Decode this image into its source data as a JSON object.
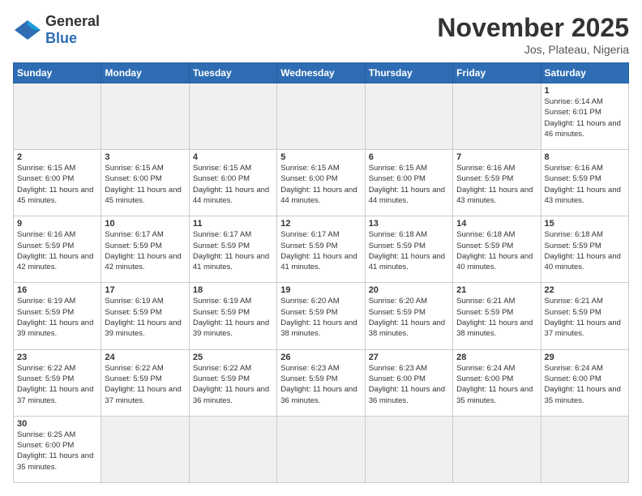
{
  "header": {
    "logo_general": "General",
    "logo_blue": "Blue",
    "month_title": "November 2025",
    "location": "Jos, Plateau, Nigeria"
  },
  "days_of_week": [
    "Sunday",
    "Monday",
    "Tuesday",
    "Wednesday",
    "Thursday",
    "Friday",
    "Saturday"
  ],
  "weeks": [
    [
      {
        "day": "",
        "info": ""
      },
      {
        "day": "",
        "info": ""
      },
      {
        "day": "",
        "info": ""
      },
      {
        "day": "",
        "info": ""
      },
      {
        "day": "",
        "info": ""
      },
      {
        "day": "",
        "info": ""
      },
      {
        "day": "1",
        "info": "Sunrise: 6:14 AM\nSunset: 6:01 PM\nDaylight: 11 hours and 46 minutes."
      }
    ],
    [
      {
        "day": "2",
        "info": "Sunrise: 6:15 AM\nSunset: 6:00 PM\nDaylight: 11 hours and 45 minutes."
      },
      {
        "day": "3",
        "info": "Sunrise: 6:15 AM\nSunset: 6:00 PM\nDaylight: 11 hours and 45 minutes."
      },
      {
        "day": "4",
        "info": "Sunrise: 6:15 AM\nSunset: 6:00 PM\nDaylight: 11 hours and 44 minutes."
      },
      {
        "day": "5",
        "info": "Sunrise: 6:15 AM\nSunset: 6:00 PM\nDaylight: 11 hours and 44 minutes."
      },
      {
        "day": "6",
        "info": "Sunrise: 6:15 AM\nSunset: 6:00 PM\nDaylight: 11 hours and 44 minutes."
      },
      {
        "day": "7",
        "info": "Sunrise: 6:16 AM\nSunset: 5:59 PM\nDaylight: 11 hours and 43 minutes."
      },
      {
        "day": "8",
        "info": "Sunrise: 6:16 AM\nSunset: 5:59 PM\nDaylight: 11 hours and 43 minutes."
      }
    ],
    [
      {
        "day": "9",
        "info": "Sunrise: 6:16 AM\nSunset: 5:59 PM\nDaylight: 11 hours and 42 minutes."
      },
      {
        "day": "10",
        "info": "Sunrise: 6:17 AM\nSunset: 5:59 PM\nDaylight: 11 hours and 42 minutes."
      },
      {
        "day": "11",
        "info": "Sunrise: 6:17 AM\nSunset: 5:59 PM\nDaylight: 11 hours and 41 minutes."
      },
      {
        "day": "12",
        "info": "Sunrise: 6:17 AM\nSunset: 5:59 PM\nDaylight: 11 hours and 41 minutes."
      },
      {
        "day": "13",
        "info": "Sunrise: 6:18 AM\nSunset: 5:59 PM\nDaylight: 11 hours and 41 minutes."
      },
      {
        "day": "14",
        "info": "Sunrise: 6:18 AM\nSunset: 5:59 PM\nDaylight: 11 hours and 40 minutes."
      },
      {
        "day": "15",
        "info": "Sunrise: 6:18 AM\nSunset: 5:59 PM\nDaylight: 11 hours and 40 minutes."
      }
    ],
    [
      {
        "day": "16",
        "info": "Sunrise: 6:19 AM\nSunset: 5:59 PM\nDaylight: 11 hours and 39 minutes."
      },
      {
        "day": "17",
        "info": "Sunrise: 6:19 AM\nSunset: 5:59 PM\nDaylight: 11 hours and 39 minutes."
      },
      {
        "day": "18",
        "info": "Sunrise: 6:19 AM\nSunset: 5:59 PM\nDaylight: 11 hours and 39 minutes."
      },
      {
        "day": "19",
        "info": "Sunrise: 6:20 AM\nSunset: 5:59 PM\nDaylight: 11 hours and 38 minutes."
      },
      {
        "day": "20",
        "info": "Sunrise: 6:20 AM\nSunset: 5:59 PM\nDaylight: 11 hours and 38 minutes."
      },
      {
        "day": "21",
        "info": "Sunrise: 6:21 AM\nSunset: 5:59 PM\nDaylight: 11 hours and 38 minutes."
      },
      {
        "day": "22",
        "info": "Sunrise: 6:21 AM\nSunset: 5:59 PM\nDaylight: 11 hours and 37 minutes."
      }
    ],
    [
      {
        "day": "23",
        "info": "Sunrise: 6:22 AM\nSunset: 5:59 PM\nDaylight: 11 hours and 37 minutes."
      },
      {
        "day": "24",
        "info": "Sunrise: 6:22 AM\nSunset: 5:59 PM\nDaylight: 11 hours and 37 minutes."
      },
      {
        "day": "25",
        "info": "Sunrise: 6:22 AM\nSunset: 5:59 PM\nDaylight: 11 hours and 36 minutes."
      },
      {
        "day": "26",
        "info": "Sunrise: 6:23 AM\nSunset: 5:59 PM\nDaylight: 11 hours and 36 minutes."
      },
      {
        "day": "27",
        "info": "Sunrise: 6:23 AM\nSunset: 6:00 PM\nDaylight: 11 hours and 36 minutes."
      },
      {
        "day": "28",
        "info": "Sunrise: 6:24 AM\nSunset: 6:00 PM\nDaylight: 11 hours and 35 minutes."
      },
      {
        "day": "29",
        "info": "Sunrise: 6:24 AM\nSunset: 6:00 PM\nDaylight: 11 hours and 35 minutes."
      }
    ],
    [
      {
        "day": "30",
        "info": "Sunrise: 6:25 AM\nSunset: 6:00 PM\nDaylight: 11 hours and 35 minutes."
      },
      {
        "day": "",
        "info": ""
      },
      {
        "day": "",
        "info": ""
      },
      {
        "day": "",
        "info": ""
      },
      {
        "day": "",
        "info": ""
      },
      {
        "day": "",
        "info": ""
      },
      {
        "day": "",
        "info": ""
      }
    ]
  ]
}
